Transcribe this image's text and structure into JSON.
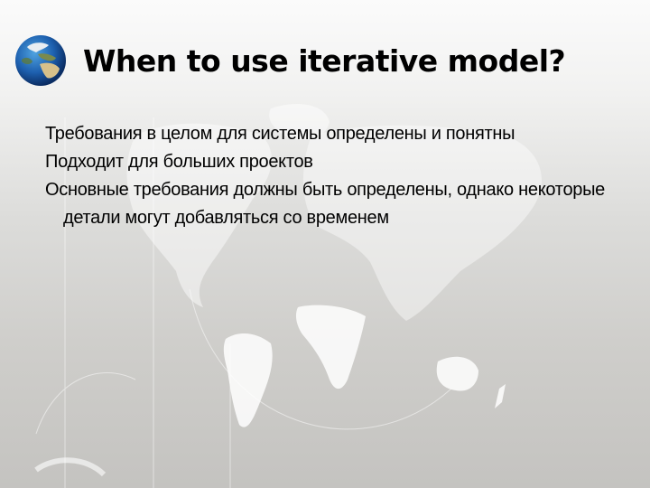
{
  "slide": {
    "title": "When to use iterative model?",
    "title_icon": "globe-icon",
    "bullets": [
      "Требования в целом для системы определены и понятны",
      "Подходит для больших проектов",
      "Основные требования должны быть определены, однако некоторые детали могут добавляться со временем"
    ]
  },
  "colors": {
    "title_text": "#000000",
    "body_text": "#000000",
    "background_top": "#fbfbfb",
    "background_bottom": "#c4c3c0",
    "map_land": "#ffffff"
  }
}
